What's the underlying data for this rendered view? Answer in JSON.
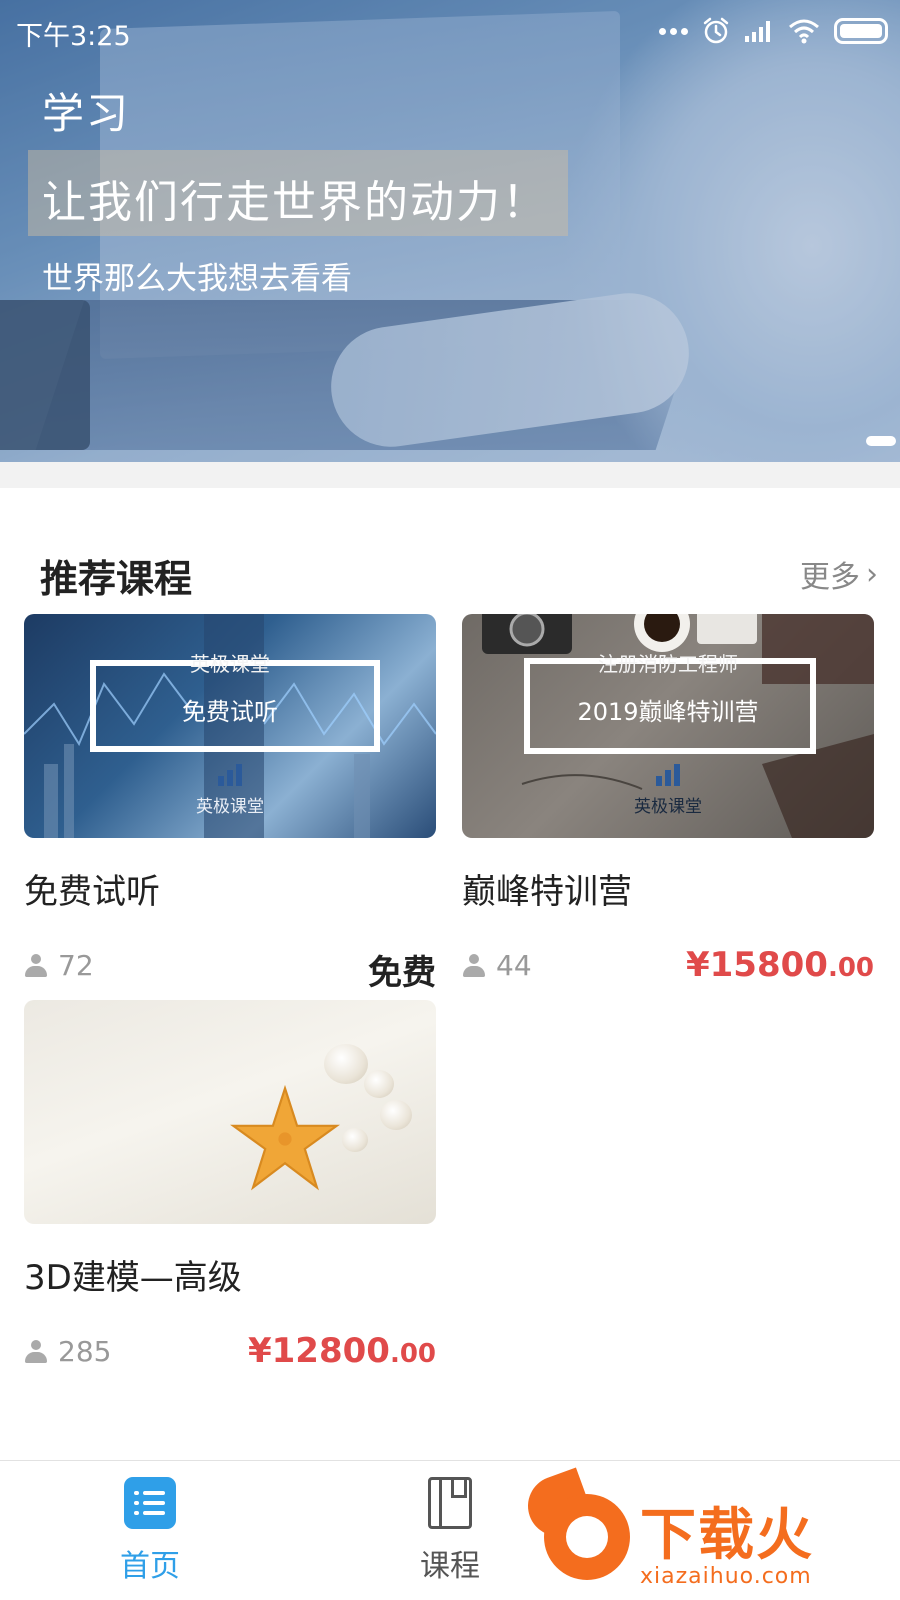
{
  "status_bar": {
    "time": "下午3:25",
    "icons": [
      "more-dots-icon",
      "alarm-icon",
      "signal-icon",
      "wifi-icon",
      "battery-icon"
    ]
  },
  "banner": {
    "title": "学习",
    "headline": "让我们行走世界的动力！",
    "subtitle": "世界那么大我想去看看",
    "pager": {
      "count": 1,
      "active": 0
    }
  },
  "section": {
    "title": "推荐课程",
    "more_label": "更多"
  },
  "courses": [
    {
      "thumb_top": "英极课堂",
      "thumb_main": "免费试听",
      "thumb_logo": "英极课堂",
      "title": "免费试听",
      "learners": "72",
      "price": "免费",
      "price_cents": ""
    },
    {
      "thumb_top": "注册消防工程师",
      "thumb_main": "2019巅峰特训营",
      "thumb_logo": "英极课堂",
      "title": "巅峰特训营",
      "learners": "44",
      "price": "¥15800",
      "price_cents": ".00"
    },
    {
      "title": "3D建模—高级",
      "learners": "285",
      "price": "¥12800",
      "price_cents": ".00"
    }
  ],
  "tabbar": {
    "tabs": [
      {
        "label": "首页",
        "icon": "list-icon",
        "active": true
      },
      {
        "label": "课程",
        "icon": "book-icon",
        "active": false
      }
    ]
  },
  "watermark": {
    "text": "下载火",
    "url": "xiazaihuo.com"
  },
  "colors": {
    "accent": "#2f9fe8",
    "price": "#e04a4a",
    "watermark": "#f46d1e"
  }
}
